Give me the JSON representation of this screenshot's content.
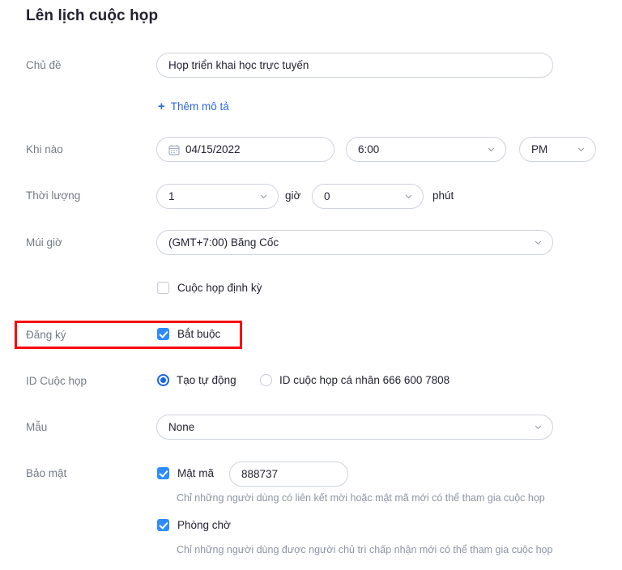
{
  "page": {
    "title": "Lên lịch cuộc họp",
    "accent_blue": "#2d8cff",
    "link_blue": "#2d68d8",
    "label_gray": "#747a85",
    "highlight_red": "#fb0007"
  },
  "form": {
    "topic": {
      "label": "Chủ đề",
      "value": "Họp triển khai học trực tuyến",
      "placeholder": "Họp triển khai học trực tuyến"
    },
    "add_description": {
      "label": "Thêm mô tả",
      "plus": "+"
    },
    "when": {
      "label": "Khi nào",
      "date": "04/15/2022",
      "time": "6:00",
      "meridiem": "PM"
    },
    "duration": {
      "label": "Thời lượng",
      "hours": "1",
      "hours_unit": "giờ",
      "minutes": "0",
      "minutes_unit": "phút"
    },
    "timezone": {
      "label": "Múi giờ",
      "value": "(GMT+7:00) Băng Cốc"
    },
    "recurring": {
      "label": "Cuộc họp định kỳ",
      "checked": false
    },
    "registration": {
      "label": "Đăng ký",
      "option_label": "Bắt buộc",
      "checked": true,
      "highlighted": true
    },
    "meeting_id": {
      "label": "ID Cuộc họp",
      "options": [
        {
          "label": "Tạo tự động",
          "selected": true
        },
        {
          "label": "ID cuộc họp cá nhân 666 600 7808",
          "selected": false
        }
      ]
    },
    "template": {
      "label": "Mẫu",
      "value": "None"
    },
    "security": {
      "label": "Bảo mật",
      "passcode": {
        "label": "Mật mã",
        "checked": true,
        "value": "888737",
        "help": "Chỉ những người dùng có liên kết mời hoặc mật mã mới có thể tham gia cuộc họp"
      },
      "waiting_room": {
        "label": "Phòng chờ",
        "checked": true,
        "help": "Chỉ những người dùng được người chủ trì chấp nhận mới có thể tham gia cuộc họp"
      }
    }
  },
  "icons": {
    "calendar": "calendar-icon",
    "chevron": "chevron-down-icon"
  }
}
